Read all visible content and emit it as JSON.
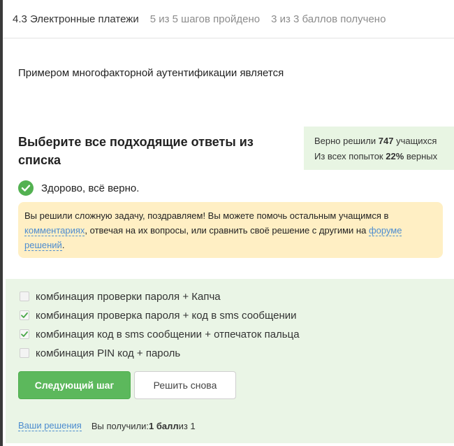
{
  "header": {
    "lesson_title": "4.3 Электронные платежи",
    "steps_progress": "5 из 5 шагов пройдено",
    "points_progress": "3 из 3 баллов  получено"
  },
  "question": {
    "text": "Примером многофакторной аутентификации является"
  },
  "task": {
    "title": "Выберите все подходящие ответы из списка"
  },
  "stats": {
    "solved_prefix": "Верно решили ",
    "solved_count": "747",
    "solved_suffix": " учащихся",
    "attempts_prefix": "Из всех попыток ",
    "attempts_percent": "22%",
    "attempts_suffix": " верных"
  },
  "result": {
    "icon": "check-circle-icon",
    "text": "Здорово, всё верно."
  },
  "congrats": {
    "text_1": "Вы решили сложную задачу, поздравляем! Вы можете помочь остальным учащимся в ",
    "link_comments": "комментариях",
    "text_2": ", отвечая на их вопросы, или сравнить своё решение с другими на ",
    "link_forum": "форуме решений",
    "text_3": "."
  },
  "options": [
    {
      "label": "комбинация проверки пароля + Капча",
      "checked": false
    },
    {
      "label": "комбинация проверка пароля + код в sms сообщении",
      "checked": true
    },
    {
      "label": "комбинация код в sms сообщении + отпечаток пальца",
      "checked": true
    },
    {
      "label": "комбинация PIN код + пароль",
      "checked": false
    }
  ],
  "buttons": {
    "next_label": "Следующий шаг",
    "retry_label": "Решить снова"
  },
  "footer": {
    "my_solutions": "Ваши решения",
    "score_prefix": "Вы получили: ",
    "score_value": "1 балл",
    "score_suffix": " из 1"
  },
  "colors": {
    "accent_green": "#5cb85c",
    "link_blue": "#4c8ccf",
    "congrats_bg": "#ffefc4",
    "answers_bg": "#eaf5e6"
  }
}
